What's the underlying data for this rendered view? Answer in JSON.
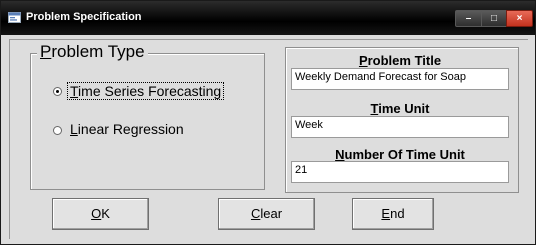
{
  "window": {
    "title": "Problem Specification",
    "icon": "app-window-icon",
    "controls": {
      "minimize": "–",
      "maximize": "□",
      "close": "×"
    }
  },
  "problem_type": {
    "legend_accel": "P",
    "legend_rest": "roblem Type",
    "options": [
      {
        "accel": "T",
        "rest": "ime Series Forecasting",
        "checked": true
      },
      {
        "accel": "L",
        "rest": "inear Regression",
        "checked": false
      }
    ]
  },
  "fields": {
    "problem_title": {
      "label_accel": "P",
      "label_rest": "roblem Title",
      "value": "Weekly Demand Forecast for Soap"
    },
    "time_unit": {
      "label_accel": "T",
      "label_rest": "ime Unit",
      "value": "Week"
    },
    "num_time_units": {
      "label_accel": "N",
      "label_rest": "umber Of Time Unit",
      "value": "21"
    }
  },
  "buttons": {
    "ok": {
      "accel": "O",
      "rest": "K"
    },
    "clear": {
      "accel": "C",
      "rest": "lear"
    },
    "end": {
      "accel": "E",
      "rest": "nd"
    }
  },
  "colors": {
    "titlebar": "#000000",
    "close": "#c8402a",
    "dialog_bg": "#dddddd"
  }
}
